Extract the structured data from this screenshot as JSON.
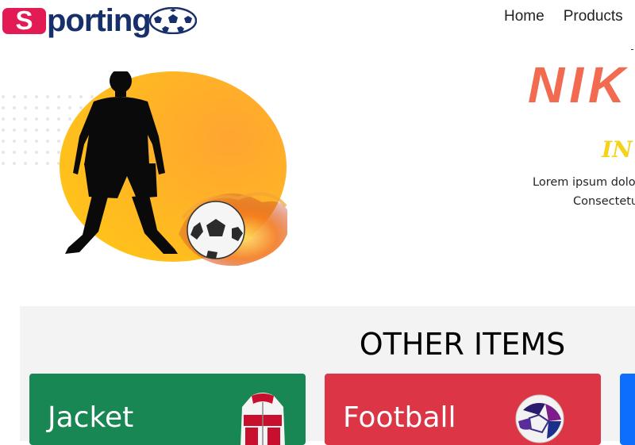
{
  "brand": {
    "logo_text": "Sporting"
  },
  "nav": {
    "items": [
      {
        "label": "Home"
      },
      {
        "label": "Products"
      }
    ]
  },
  "hero": {
    "title": "NIK",
    "subtitle": "IN",
    "text_line1": "Lorem ipsum dolo",
    "text_line2": "Consectetu"
  },
  "other_items": {
    "heading": "OTHER ITEMS",
    "cards": [
      {
        "label": "Jacket",
        "color": "#198754",
        "image_icon": "jacket-icon"
      },
      {
        "label": "Football",
        "color": "#dc3545",
        "image_icon": "football-icon"
      },
      {
        "label": "",
        "color": "#0d6efd"
      }
    ]
  },
  "colors": {
    "logo_red": "#e31b54",
    "logo_navy": "#17306b",
    "title_orange": "#f26a4f",
    "subtitle_yellow": "#f5d21c"
  }
}
